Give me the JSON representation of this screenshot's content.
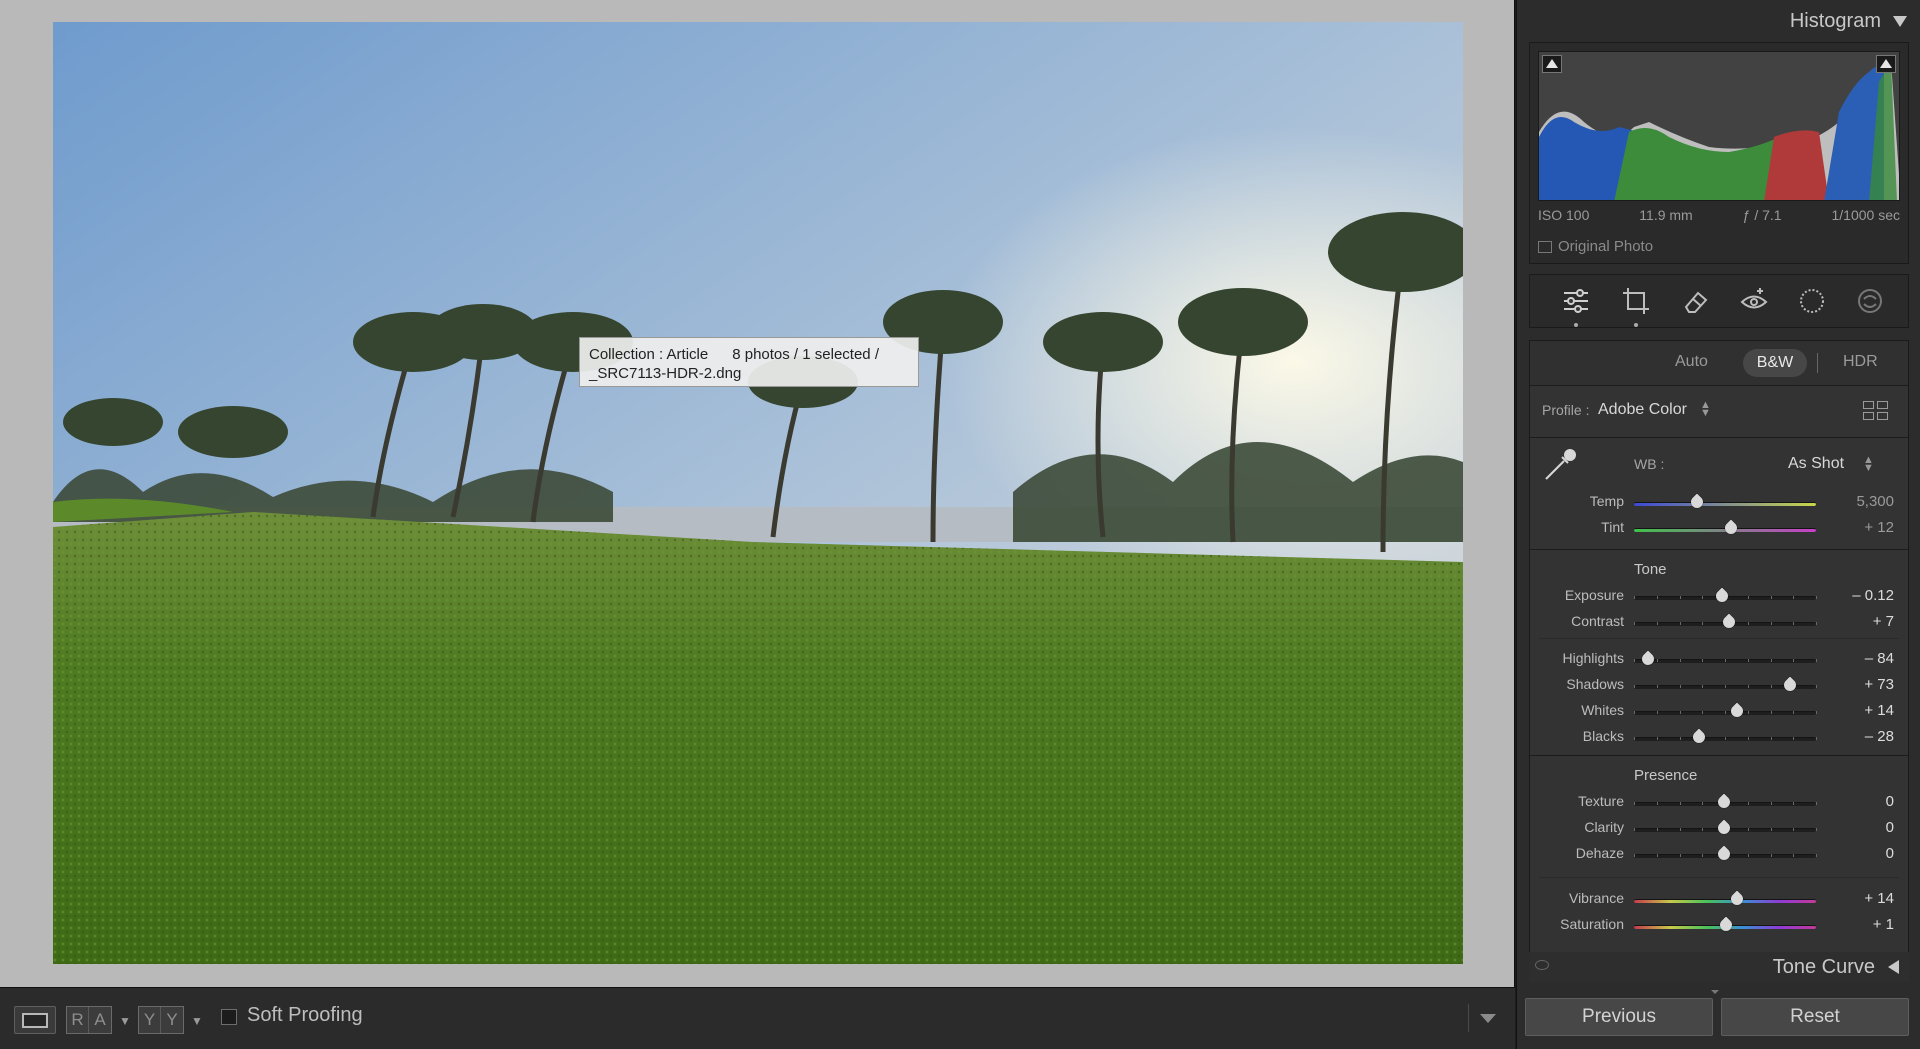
{
  "viewer": {
    "tooltip": {
      "collection": "Collection : Article",
      "count": "8 photos / 1 selected /",
      "filename": "_SRC7113-HDR-2.dng"
    }
  },
  "toolbar": {
    "compare_before_after_label": "R A",
    "compare_yy_label": "Y Y",
    "soft_proofing_label": "Soft Proofing",
    "soft_proofing_checked": false
  },
  "histogram": {
    "title": "Histogram",
    "exif": {
      "iso": "ISO 100",
      "focal_length": "11.9 mm",
      "aperture": "ƒ / 7.1",
      "shutter": "1/1000 sec"
    },
    "original_photo_label": "Original Photo",
    "original_photo_checked": false
  },
  "tools": [
    {
      "name": "edit-sliders-icon",
      "active": true
    },
    {
      "name": "crop-icon",
      "active": true
    },
    {
      "name": "eraser-icon",
      "active": false
    },
    {
      "name": "red-eye-icon",
      "active": false
    },
    {
      "name": "masking-icon",
      "active": false
    },
    {
      "name": "presets-icon",
      "active": false
    }
  ],
  "basic": {
    "modes": {
      "auto": "Auto",
      "bw": "B&W",
      "hdr": "HDR"
    },
    "profile": {
      "label": "Profile :",
      "value": "Adobe Color"
    },
    "wb": {
      "label": "WB :",
      "value": "As Shot"
    },
    "sliders": {
      "temp": {
        "label": "Temp",
        "value": "5,300",
        "position": 0.35
      },
      "tint": {
        "label": "Tint",
        "value": "+ 12",
        "position": 0.54
      },
      "tone_title": "Tone",
      "exposure": {
        "label": "Exposure",
        "value": "– 0.12",
        "position": 0.49
      },
      "contrast": {
        "label": "Contrast",
        "value": "+ 7",
        "position": 0.53
      },
      "highlights": {
        "label": "Highlights",
        "value": "– 84",
        "position": 0.08
      },
      "shadows": {
        "label": "Shadows",
        "value": "+ 73",
        "position": 0.86
      },
      "whites": {
        "label": "Whites",
        "value": "+ 14",
        "position": 0.57
      },
      "blacks": {
        "label": "Blacks",
        "value": "– 28",
        "position": 0.36
      },
      "presence_title": "Presence",
      "texture": {
        "label": "Texture",
        "value": "0",
        "position": 0.5
      },
      "clarity": {
        "label": "Clarity",
        "value": "0",
        "position": 0.5
      },
      "dehaze": {
        "label": "Dehaze",
        "value": "0",
        "position": 0.5
      },
      "vibrance": {
        "label": "Vibrance",
        "value": "+ 14",
        "position": 0.57
      },
      "saturation": {
        "label": "Saturation",
        "value": "+ 1",
        "position": 0.51
      }
    }
  },
  "tone_curve": {
    "title": "Tone Curve"
  },
  "buttons": {
    "previous": "Previous",
    "reset": "Reset"
  },
  "colors": {
    "panel": "#383838",
    "canvas": "#b9b9b9",
    "accent": "#c8c8c8"
  }
}
